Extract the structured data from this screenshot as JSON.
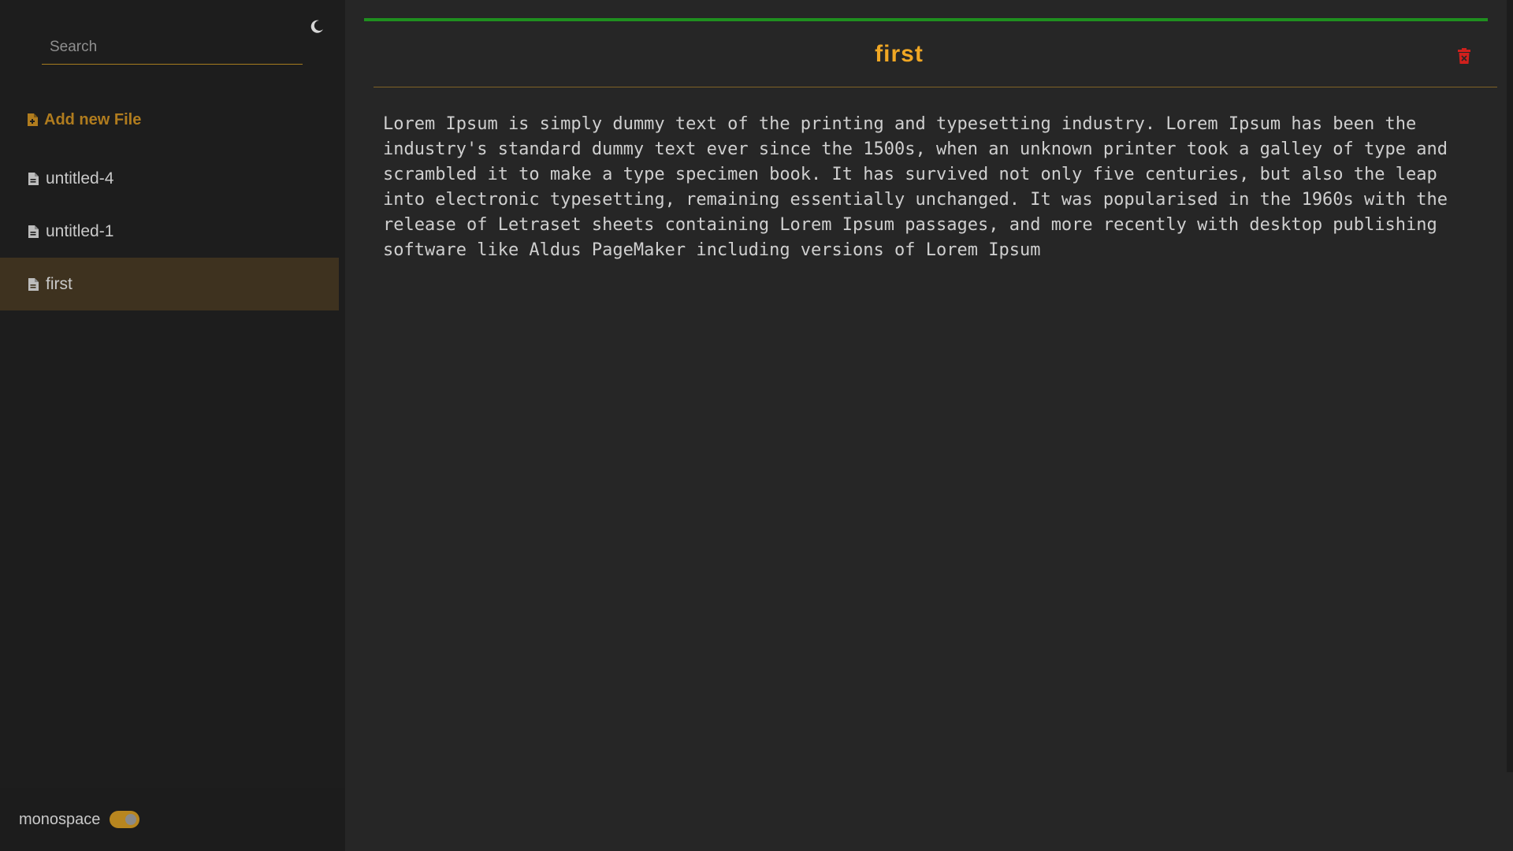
{
  "sidebar": {
    "search": {
      "placeholder": "Search",
      "value": ""
    },
    "theme_toggle_icon": "moon-icon",
    "add_file_label": "Add new File",
    "files": [
      {
        "name": "untitled-4",
        "active": false
      },
      {
        "name": "untitled-1",
        "active": false
      },
      {
        "name": "first",
        "active": true
      }
    ],
    "monospace": {
      "label": "monospace",
      "enabled": true
    }
  },
  "editor": {
    "title": "first",
    "delete_icon": "trash-icon",
    "content": "Lorem Ipsum is simply dummy text of the printing and typesetting industry. Lorem Ipsum has been the industry's standard dummy text ever since the 1500s, when an unknown printer took a galley of type and scrambled it to make a type specimen book. It has survived not only five centuries, but also the leap into electronic typesetting, remaining essentially unchanged. It was popularised in the 1960s with the release of Letraset sheets containing Lorem Ipsum passages, and more recently with desktop publishing software like Aldus PageMaker including versions of Lorem Ipsum"
  },
  "colors": {
    "accent": "#f0a724",
    "add_file": "#b07c1e",
    "active_bg": "#3e321f",
    "progress": "#1f8f1f",
    "delete": "#d0201c"
  }
}
